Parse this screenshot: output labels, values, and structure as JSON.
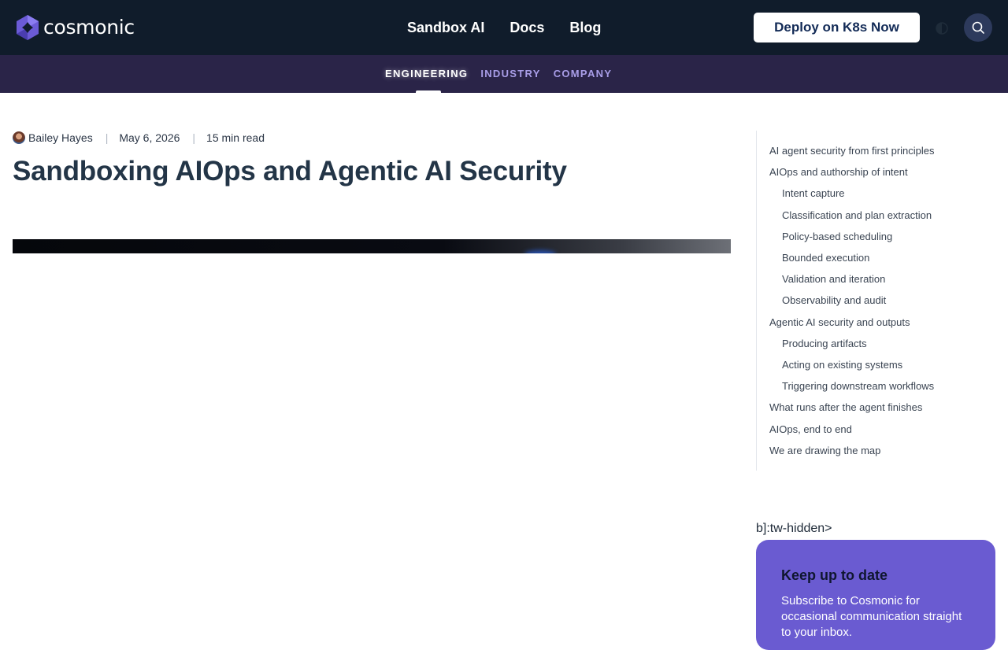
{
  "brand": {
    "name": "cosmonic",
    "colors": {
      "topbar": "#101c2b",
      "subnav": "#2a2448",
      "accent": "#6a5bd1",
      "title": "#233547"
    }
  },
  "nav": {
    "items": [
      "Sandbox AI",
      "Docs",
      "Blog"
    ],
    "cta_label": "Deploy on K8s Now",
    "theme_icon": "half-moon-icon",
    "search_icon": "search-icon"
  },
  "subnav": {
    "items": [
      "ENGINEERING",
      "INDUSTRY",
      "COMPANY"
    ],
    "active": "ENGINEERING"
  },
  "article": {
    "author": "Bailey Hayes",
    "date": "May 6, 2026",
    "read_time": "15 min read",
    "title": "Sandboxing AIOps and Agentic AI Security"
  },
  "toc": [
    {
      "label": "AI agent security from first principles",
      "level": 1
    },
    {
      "label": "AIOps and authorship of intent",
      "level": 1
    },
    {
      "label": "Intent capture",
      "level": 2
    },
    {
      "label": "Classification and plan extraction",
      "level": 2
    },
    {
      "label": "Policy-based scheduling",
      "level": 2
    },
    {
      "label": "Bounded execution",
      "level": 2
    },
    {
      "label": "Validation and iteration",
      "level": 2
    },
    {
      "label": "Observability and audit",
      "level": 2
    },
    {
      "label": "Agentic AI security and outputs",
      "level": 1
    },
    {
      "label": "Producing artifacts",
      "level": 2
    },
    {
      "label": "Acting on existing systems",
      "level": 2
    },
    {
      "label": "Triggering downstream workflows",
      "level": 2
    },
    {
      "label": "What runs after the agent finishes",
      "level": 1
    },
    {
      "label": "AIOps, end to end",
      "level": 1
    },
    {
      "label": "We are drawing the map",
      "level": 1
    }
  ],
  "stray_text": "b]:tw-hidden>",
  "newsletter": {
    "title": "Keep up to date",
    "body": "Subscribe to Cosmonic for occasional communication straight to your inbox."
  }
}
